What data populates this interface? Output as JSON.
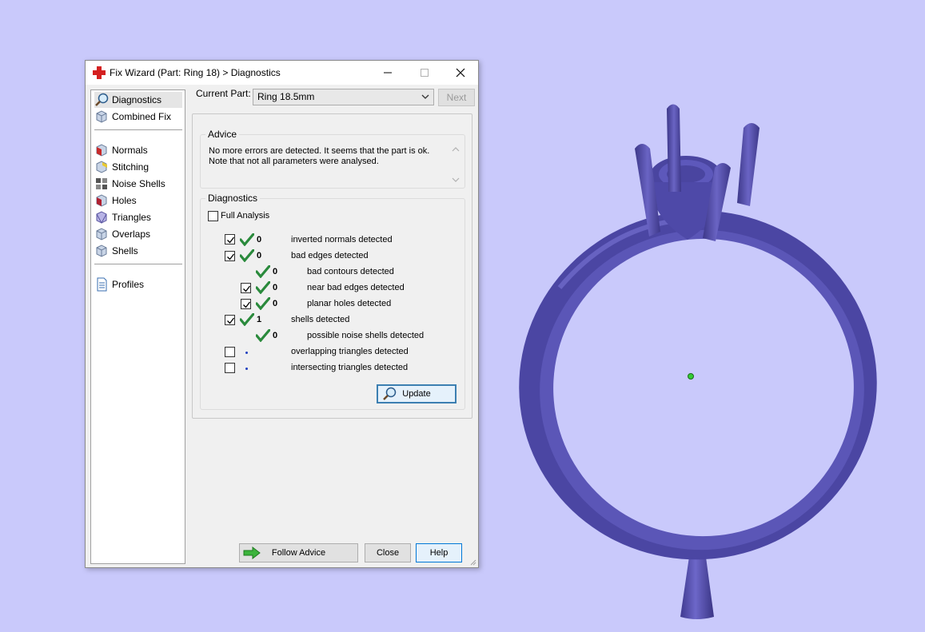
{
  "dialog": {
    "title": "Fix Wizard (Part: Ring 18) > Diagnostics"
  },
  "nav": {
    "items": [
      {
        "label": "Diagnostics",
        "icon": "magnifier-icon",
        "selected": true
      },
      {
        "label": "Combined Fix",
        "icon": "combined-fix-icon"
      },
      {
        "label": "Normals",
        "icon": "normals-cube-icon"
      },
      {
        "label": "Stitching",
        "icon": "stitching-cube-icon"
      },
      {
        "label": "Noise Shells",
        "icon": "noise-shells-icon"
      },
      {
        "label": "Holes",
        "icon": "holes-cube-icon"
      },
      {
        "label": "Triangles",
        "icon": "triangles-cube-icon"
      },
      {
        "label": "Overlaps",
        "icon": "overlaps-cube-icon"
      },
      {
        "label": "Shells",
        "icon": "shells-cube-icon"
      },
      {
        "label": "Profiles",
        "icon": "profiles-doc-icon"
      }
    ]
  },
  "current_part": {
    "label": "Current Part:",
    "value": "Ring 18.5mm",
    "next_label": "Next"
  },
  "advice": {
    "title": "Advice",
    "lines": [
      "No more errors are detected. It seems that the part is ok.",
      "Note that not all parameters were analysed."
    ]
  },
  "diagnostics": {
    "title": "Diagnostics",
    "full_analysis_label": "Full Analysis",
    "full_analysis_checked": false,
    "rows": [
      {
        "checked": true,
        "status": "ok",
        "count": "0",
        "label": "inverted normals detected"
      },
      {
        "checked": true,
        "status": "ok",
        "count": "0",
        "label": "bad edges detected"
      },
      {
        "checked": null,
        "status": "ok",
        "count": "0",
        "label": "bad contours detected"
      },
      {
        "checked": true,
        "status": "ok",
        "count": "0",
        "label": "near bad edges detected"
      },
      {
        "checked": true,
        "status": "ok",
        "count": "0",
        "label": "planar holes detected"
      },
      {
        "checked": true,
        "status": "ok",
        "count": "1",
        "label": "shells detected"
      },
      {
        "checked": null,
        "status": "ok",
        "count": "0",
        "label": "possible noise shells detected"
      },
      {
        "checked": false,
        "status": "not-run",
        "count": "",
        "label": "overlapping triangles detected"
      },
      {
        "checked": false,
        "status": "not-run",
        "count": "",
        "label": "intersecting triangles detected"
      }
    ],
    "update_label": "Update"
  },
  "buttons": {
    "follow_advice": "Follow Advice",
    "close": "Close",
    "help": "Help"
  },
  "colors": {
    "viewport_background": "#c9c9fb",
    "ring_color": "#5a55b0",
    "check_green": "#2a8a3c"
  }
}
